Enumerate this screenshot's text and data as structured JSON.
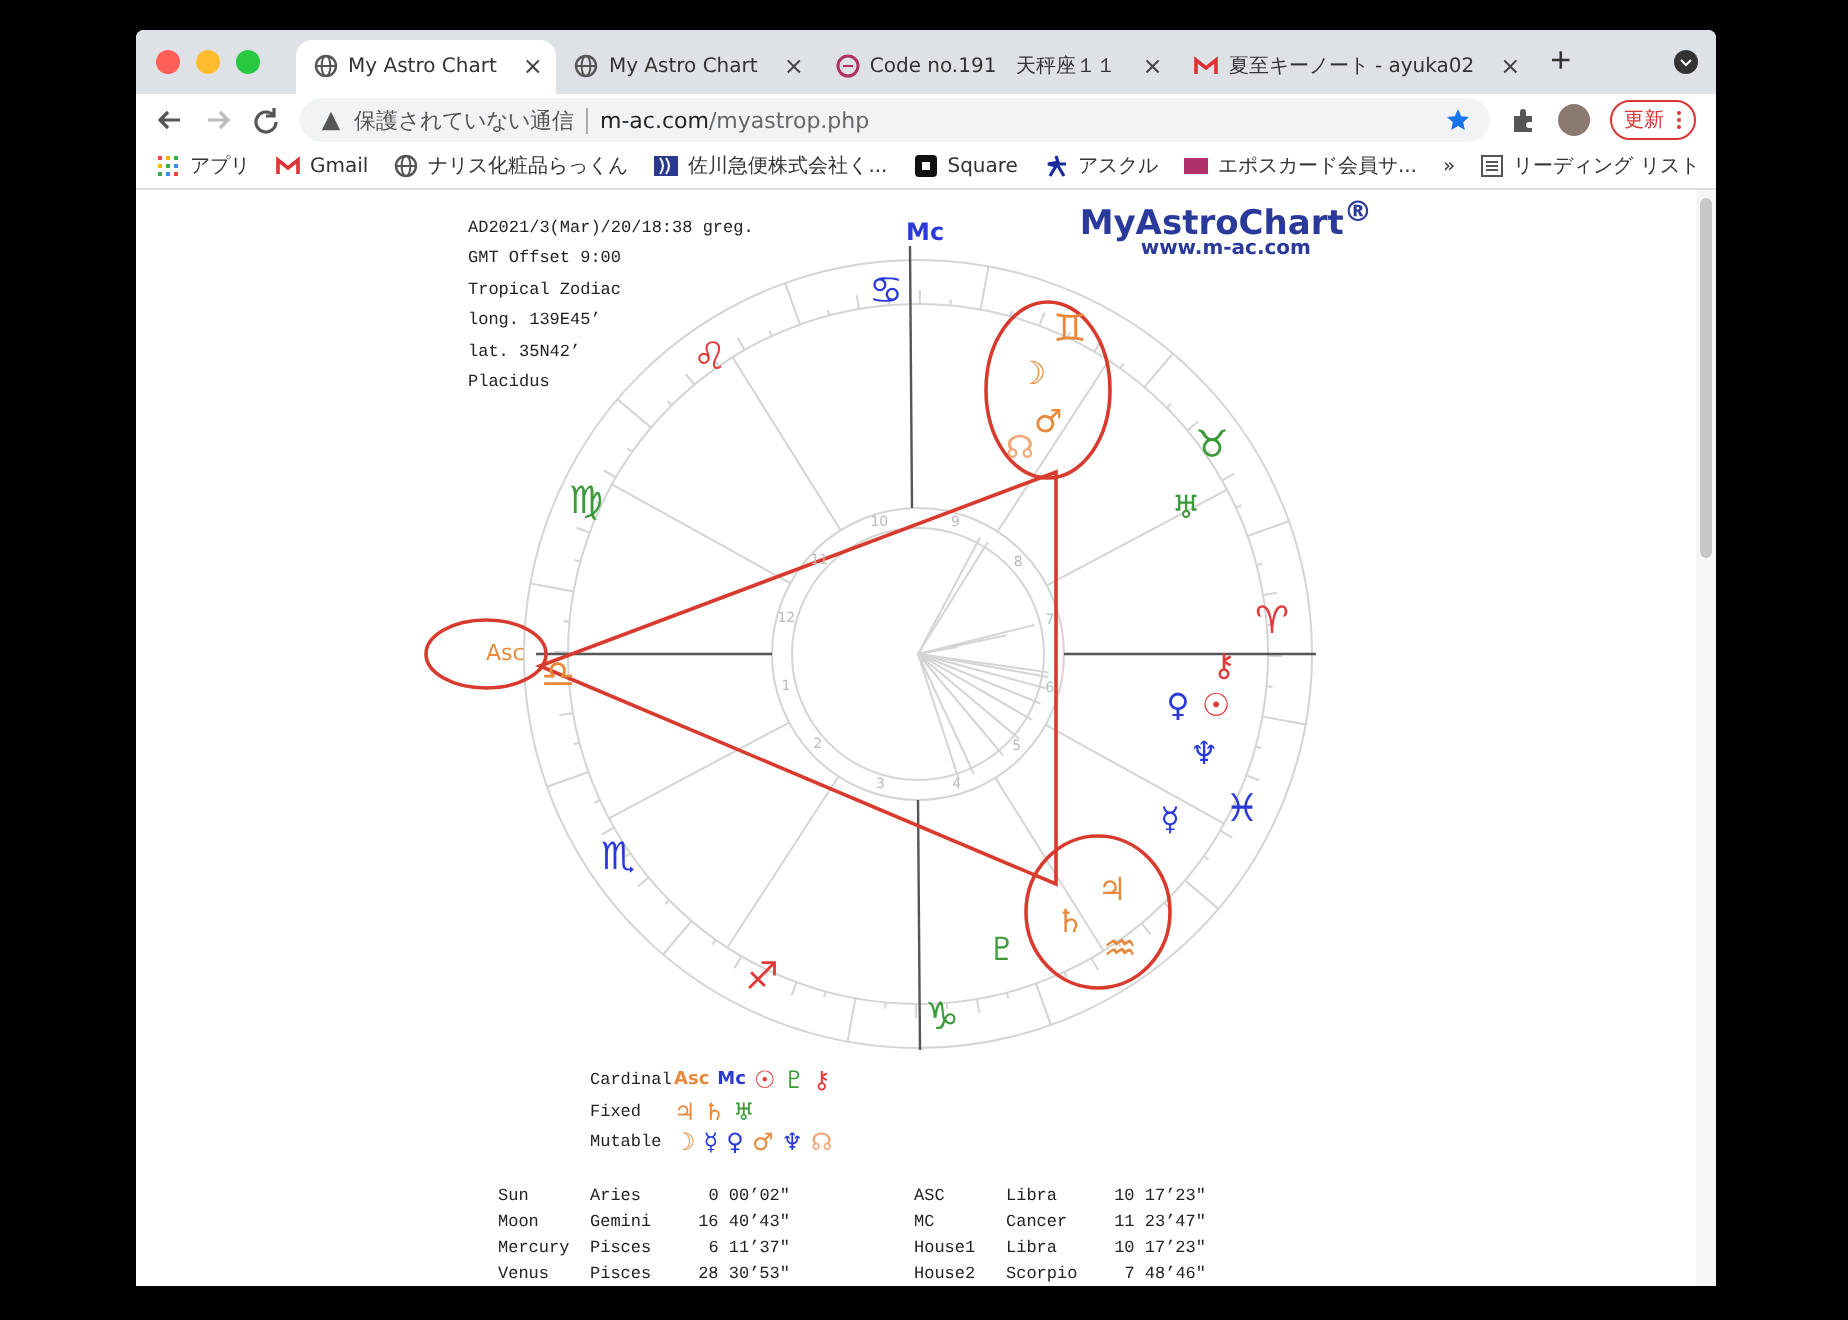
{
  "browser": {
    "tabs": [
      {
        "title": "My Astro Chart",
        "close": "×",
        "selected": true
      },
      {
        "title": "My Astro Chart",
        "close": "×",
        "selected": false
      },
      {
        "title": "Code no.191　天秤座１１",
        "close": "×",
        "selected": false
      },
      {
        "title": "夏至キーノート - ayuka02",
        "close": "×",
        "selected": false
      }
    ],
    "new_tab": "+",
    "address": {
      "security_label": "保護されていない通信",
      "host": "m-ac.com",
      "path": "/myastrop.php"
    },
    "update_button": "更新",
    "bookmarks": [
      {
        "label": "アプリ"
      },
      {
        "label": "Gmail"
      },
      {
        "label": "ナリス化粧品らっくん"
      },
      {
        "label": "佐川急便株式会社く..."
      },
      {
        "label": "Square"
      },
      {
        "label": "アスクル"
      },
      {
        "label": "エポスカード会員サ..."
      }
    ],
    "more_bookmarks": "»",
    "reading_list": "リーディング リスト"
  },
  "chart": {
    "header_lines": [
      "AD2021/3(Mar)/20/18:38 greg.",
      "GMT Offset 9:00",
      "Tropical Zodiac",
      "long. 139E45’",
      "lat. 35N42’",
      "Placidus"
    ],
    "logo": {
      "title": "MyAstroChart$^{®}$",
      "url": "www.m-ac.com"
    },
    "mc_label": "Mc",
    "asc_label": "Asc",
    "signs": [
      {
        "glyph": "♈",
        "color": "#e03a3a"
      },
      {
        "glyph": "♉",
        "color": "#3a9a3a"
      },
      {
        "glyph": "♊",
        "color": "#e8883a"
      },
      {
        "glyph": "♋",
        "color": "#2a3ad8"
      },
      {
        "glyph": "♌",
        "color": "#e03a3a"
      },
      {
        "glyph": "♍",
        "color": "#3a9a3a"
      },
      {
        "glyph": "♎",
        "color": "#e8883a"
      },
      {
        "glyph": "♏",
        "color": "#2a3ad8"
      },
      {
        "glyph": "♐",
        "color": "#e03a3a"
      },
      {
        "glyph": "♑",
        "color": "#3a9a3a"
      },
      {
        "glyph": "♒",
        "color": "#e8883a"
      },
      {
        "glyph": "♓",
        "color": "#2a3ad8"
      }
    ],
    "planets": [
      {
        "glyph": "☽",
        "color": "#e8883a"
      },
      {
        "glyph": "♂",
        "color": "#e8883a"
      },
      {
        "glyph": "☊",
        "color": "#f0a878"
      },
      {
        "glyph": "♅",
        "color": "#3a9a3a"
      },
      {
        "glyph": "⚷",
        "color": "#e03a3a"
      },
      {
        "glyph": "♀",
        "color": "#2a3ad8"
      },
      {
        "glyph": "☉",
        "color": "#e03a3a"
      },
      {
        "glyph": "♆",
        "color": "#2a3ad8"
      },
      {
        "glyph": "☿",
        "color": "#2a3ad8"
      },
      {
        "glyph": "♃",
        "color": "#e8883a"
      },
      {
        "glyph": "♄",
        "color": "#e8883a"
      },
      {
        "glyph": "♇",
        "color": "#3a9a3a"
      }
    ],
    "house_numbers": [
      "1",
      "2",
      "3",
      "4",
      "5",
      "6",
      "7",
      "8",
      "9",
      "10",
      "11",
      "12"
    ]
  },
  "legend": [
    {
      "label": "Cardinal",
      "items": [
        {
          "symbol": "Asc",
          "color": "#e8883a"
        },
        {
          "symbol": "Mc",
          "color": "#2a3ad8"
        },
        {
          "symbol": "☉",
          "color": "#e03a3a"
        },
        {
          "symbol": "♇",
          "color": "#3a9a3a"
        },
        {
          "symbol": "⚷",
          "color": "#e03a3a"
        }
      ]
    },
    {
      "label": "Fixed",
      "items": [
        {
          "symbol": "♃",
          "color": "#e8883a"
        },
        {
          "symbol": "♄",
          "color": "#e8883a"
        },
        {
          "symbol": "♅",
          "color": "#3a9a3a"
        }
      ]
    },
    {
      "label": "Mutable",
      "items": [
        {
          "symbol": "☽",
          "color": "#e8883a"
        },
        {
          "symbol": "☿",
          "color": "#2a3ad8"
        },
        {
          "symbol": "♀",
          "color": "#2a3ad8"
        },
        {
          "symbol": "♂",
          "color": "#e8883a"
        },
        {
          "symbol": "♆",
          "color": "#2a3ad8"
        },
        {
          "symbol": "☊",
          "color": "#f0a878"
        }
      ]
    }
  ],
  "positions": {
    "left": [
      {
        "body": "Sun",
        "sign": "Aries",
        "degree": "0 00’02\""
      },
      {
        "body": "Moon",
        "sign": "Gemini",
        "degree": "16 40’43\""
      },
      {
        "body": "Mercury",
        "sign": "Pisces",
        "degree": "6 11’37\""
      },
      {
        "body": "Venus",
        "sign": "Pisces",
        "degree": "28 30’53\""
      }
    ],
    "right": [
      {
        "body": "ASC",
        "sign": "Libra",
        "degree": "10 17’23\""
      },
      {
        "body": "MC",
        "sign": "Cancer",
        "degree": "11 23’47\""
      },
      {
        "body": "House1",
        "sign": "Libra",
        "degree": "10 17’23\""
      },
      {
        "body": "House2",
        "sign": "Scorpio",
        "degree": "7 48’46\""
      }
    ]
  }
}
